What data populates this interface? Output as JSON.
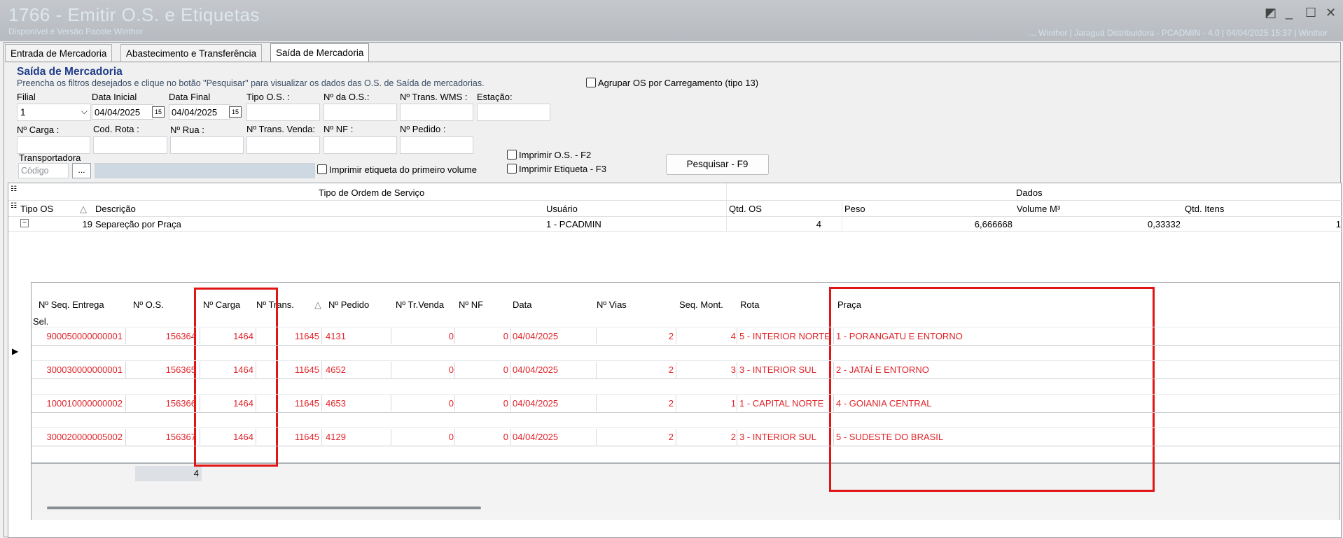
{
  "window": {
    "title": "1766 - Emitir O.S. e Etiquetas",
    "subtitle": "Disponível e Versão Pacote Winthor",
    "info": "... Winthor | Jaraguá Distribuidora - PCADMIN - 4.0 | 04/04/2025 15:37 | Winthor"
  },
  "tabs": [
    "Entrada de Mercadoria",
    "Abastecimento e Transferência",
    "Saída de Mercadoria"
  ],
  "section": {
    "title": "Saída de Mercadoria",
    "instructions": "Preencha os filtros desejados e clique no botão \"Pesquisar\" para visualizar os dados das O.S. de Saída de mercadorias."
  },
  "filters": {
    "agrupar": "Agrupar OS por Carregamento (tipo 13)",
    "filial_label": "Filial",
    "filial_value": "1",
    "data_inicial_label": "Data Inicial",
    "data_inicial_value": "04/04/2025",
    "data_final_label": "Data Final",
    "data_final_value": "04/04/2025",
    "tipo_os_label": "Tipo O.S. :",
    "num_os_label": "Nº da O.S.:",
    "num_trans_wms_label": "Nº Trans. WMS :",
    "estacao_label": "Estação:",
    "carga_label": "Nº Carga :",
    "cod_rota_label": "Cod. Rota :",
    "rua_label": "Nº Rua :",
    "trans_venda_label": "Nº Trans. Venda:",
    "nf_label": "Nº NF :",
    "pedido_label": "Nº Pedido :",
    "transportadora_label": "Transportadora",
    "codigo_placeholder": "Código",
    "ellipsis": "...",
    "imprimir_etiqueta_primeiro": "Imprimir etiqueta do primeiro volume",
    "imprimir_os": "Imprimir O.S. - F2",
    "imprimir_etiqueta": "Imprimir Etiqueta - F3",
    "pesquisar": "Pesquisar - F9",
    "cal_icon_text": "15"
  },
  "grid": {
    "band_left": "Tipo de Ordem de Serviço",
    "band_right": "Dados",
    "columns": [
      "Tipo OS",
      "Descrição",
      "Usuário",
      "Qtd. OS",
      "Peso",
      "Volume M³",
      "Qtd. Itens"
    ],
    "sort_glyph": "△",
    "group_row": {
      "tipo": "19",
      "descricao": "Separeção por Praça",
      "usuario": "1 - PCADMIN",
      "qtd_os": "4",
      "peso": "6,666668",
      "volume": "0,33332",
      "qtd_itens": "1"
    }
  },
  "detail": {
    "columns": [
      "Nº Seq. Entrega",
      "Nº O.S.",
      "Nº Carga",
      "Nº Trans.",
      "Nº Pedido",
      "Nº Tr.Venda",
      "Nº NF",
      "Data",
      "Nº Vias",
      "Seq. Mont.",
      "Rota",
      "Praça"
    ],
    "sel_label": "Sel.",
    "rows": [
      {
        "seq": "900050000000001",
        "os": "156364",
        "carga": "1464",
        "trans": "11645",
        "pedido": "4131",
        "trvenda": "0",
        "nf": "0",
        "data": "04/04/2025",
        "vias": "2",
        "seqmont": "4",
        "rota": "5 - INTERIOR NORTE",
        "praca": "1 - PORANGATU E ENTORNO"
      },
      {
        "seq": "300030000000001",
        "os": "156365",
        "carga": "1464",
        "trans": "11645",
        "pedido": "4652",
        "trvenda": "0",
        "nf": "0",
        "data": "04/04/2025",
        "vias": "2",
        "seqmont": "3",
        "rota": "3 - INTERIOR SUL",
        "praca": "2 - JATAÍ E ENTORNO"
      },
      {
        "seq": "100010000000002",
        "os": "156366",
        "carga": "1464",
        "trans": "11645",
        "pedido": "4653",
        "trvenda": "0",
        "nf": "0",
        "data": "04/04/2025",
        "vias": "2",
        "seqmont": "1",
        "rota": "1 - CAPITAL NORTE",
        "praca": "4 - GOIANIA CENTRAL"
      },
      {
        "seq": "300020000005002",
        "os": "156367",
        "carga": "1464",
        "trans": "11645",
        "pedido": "4129",
        "trvenda": "0",
        "nf": "0",
        "data": "04/04/2025",
        "vias": "2",
        "seqmont": "2",
        "rota": "3 - INTERIOR SUL",
        "praca": "5 - SUDESTE DO BRASIL"
      }
    ],
    "footer_count": "4"
  },
  "colors": {
    "row_text": "#e0242a",
    "highlight": "#e01515"
  }
}
